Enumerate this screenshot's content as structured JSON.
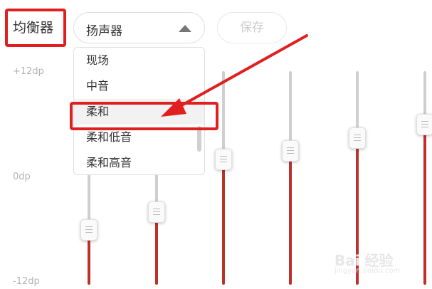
{
  "header": {
    "title": "均衡器",
    "dropdown_value": "扬声器",
    "save_label": "保存"
  },
  "axis": {
    "top": "+12dp",
    "mid": "0dp",
    "bottom": "-12dp"
  },
  "dropdown_menu": {
    "items": [
      "现场",
      "中音",
      "柔和",
      "柔和低音",
      "柔和高音"
    ],
    "selected": "柔和"
  },
  "sliders": {
    "count_visible": 6,
    "levels_db": [
      -6,
      -4,
      2,
      3,
      4.5,
      6
    ]
  },
  "watermark": {
    "main": "Bai 经验",
    "sub": "jingyan.baidu.com"
  },
  "colors": {
    "highlight": "#e02020",
    "slider_fill": "#c0302a",
    "slider_rail": "#cfcfcf"
  }
}
